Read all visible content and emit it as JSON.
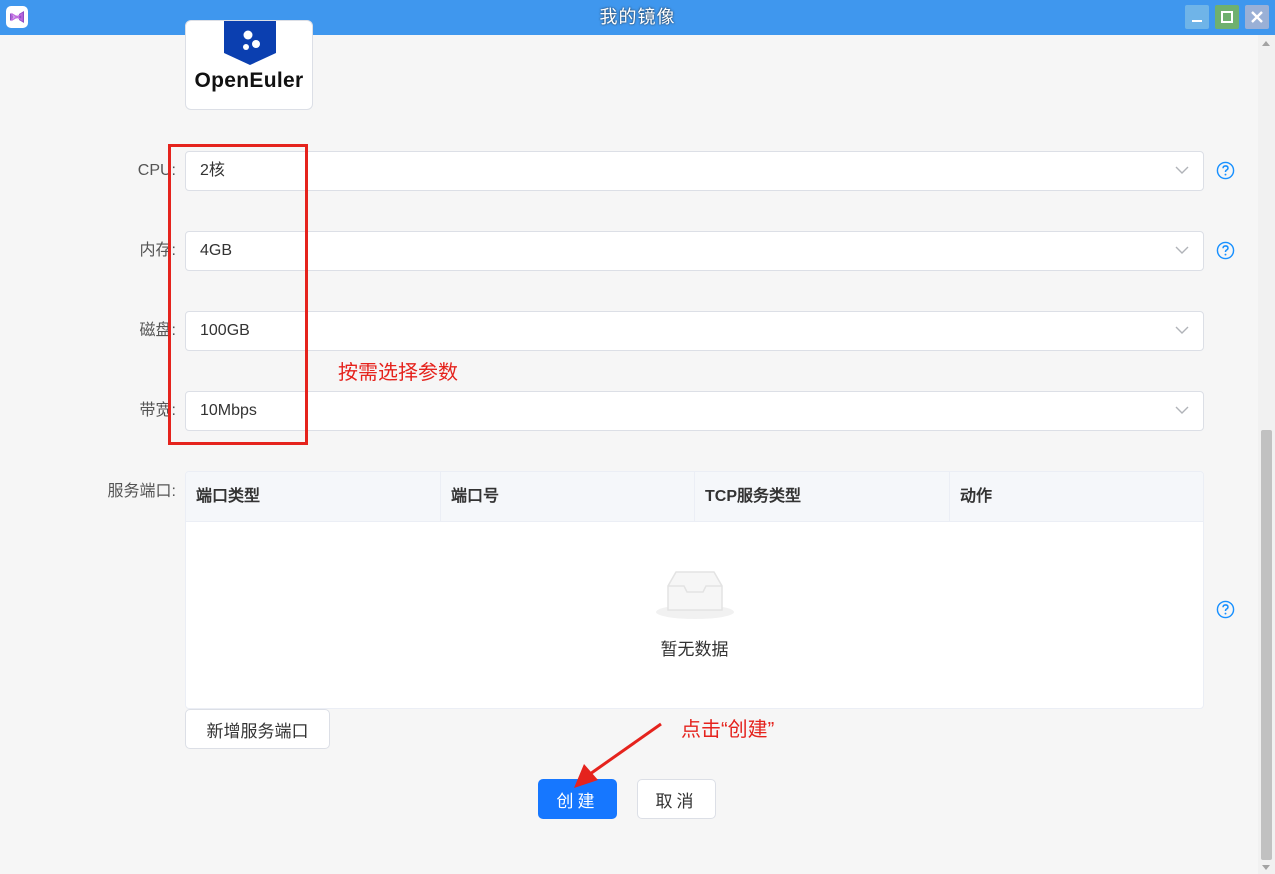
{
  "window": {
    "title": "我的镜像",
    "app_icon": "visual-studio-icon",
    "controls": {
      "minimize": "minimize-icon",
      "maximize": "maximize-icon",
      "close": "close-icon"
    }
  },
  "image_logo": {
    "text": "OpenEuler"
  },
  "form": {
    "cpu": {
      "label": "CPU:",
      "value": "2核"
    },
    "memory": {
      "label": "内存:",
      "value": "4GB"
    },
    "disk": {
      "label": "磁盘:",
      "value": "100GB"
    },
    "bandwidth": {
      "label": "带宽:",
      "value": "10Mbps"
    },
    "ports": {
      "label": "服务端口:",
      "columns": [
        "端口类型",
        "端口号",
        "TCP服务类型",
        "动作"
      ],
      "empty_text": "暂无数据",
      "add_label": "新增服务端口"
    }
  },
  "actions": {
    "create_label": "创建",
    "cancel_label": "取消"
  },
  "annotations": {
    "params_note": "按需选择参数",
    "create_note": "点击“创建”",
    "color": "#e5231d"
  },
  "colors": {
    "titlebar": "#3f97ee",
    "primary": "#1677ff",
    "help": "#1890ff"
  }
}
